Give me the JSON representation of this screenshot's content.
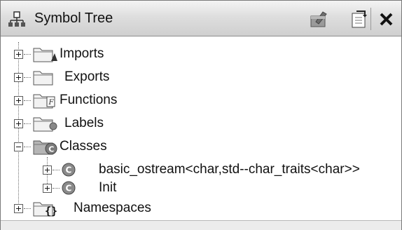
{
  "window": {
    "title": "Symbol Tree",
    "icons": [
      "symbol-tree-icon",
      "mark-icon",
      "navigate-icon",
      "close-icon"
    ]
  },
  "tree": {
    "nodes": [
      {
        "label": "Imports",
        "icon": "folder-imports-icon",
        "expanded": false
      },
      {
        "label": "Exports",
        "icon": "folder-icon",
        "expanded": false
      },
      {
        "label": "Functions",
        "icon": "folder-functions-icon",
        "expanded": false
      },
      {
        "label": "Labels",
        "icon": "folder-labels-icon",
        "expanded": false
      },
      {
        "label": "Classes",
        "icon": "folder-classes-icon",
        "expanded": true,
        "children": [
          {
            "label": "basic_ostream<char,std--char_traits<char>>",
            "icon": "class-icon",
            "expanded": false
          },
          {
            "label": "Init",
            "icon": "class-icon",
            "expanded": false
          }
        ]
      },
      {
        "label": "Namespaces",
        "icon": "folder-namespaces-icon",
        "expanded": false
      }
    ]
  }
}
